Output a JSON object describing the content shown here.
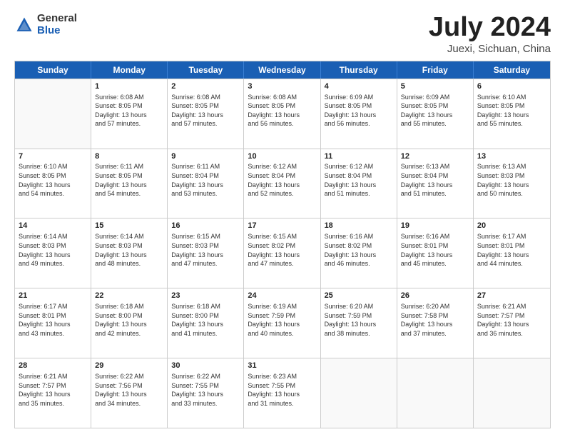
{
  "logo": {
    "general": "General",
    "blue": "Blue"
  },
  "title": "July 2024",
  "subtitle": "Juexi, Sichuan, China",
  "header_days": [
    "Sunday",
    "Monday",
    "Tuesday",
    "Wednesday",
    "Thursday",
    "Friday",
    "Saturday"
  ],
  "weeks": [
    [
      {
        "day": "",
        "info": ""
      },
      {
        "day": "1",
        "info": "Sunrise: 6:08 AM\nSunset: 8:05 PM\nDaylight: 13 hours\nand 57 minutes."
      },
      {
        "day": "2",
        "info": "Sunrise: 6:08 AM\nSunset: 8:05 PM\nDaylight: 13 hours\nand 57 minutes."
      },
      {
        "day": "3",
        "info": "Sunrise: 6:08 AM\nSunset: 8:05 PM\nDaylight: 13 hours\nand 56 minutes."
      },
      {
        "day": "4",
        "info": "Sunrise: 6:09 AM\nSunset: 8:05 PM\nDaylight: 13 hours\nand 56 minutes."
      },
      {
        "day": "5",
        "info": "Sunrise: 6:09 AM\nSunset: 8:05 PM\nDaylight: 13 hours\nand 55 minutes."
      },
      {
        "day": "6",
        "info": "Sunrise: 6:10 AM\nSunset: 8:05 PM\nDaylight: 13 hours\nand 55 minutes."
      }
    ],
    [
      {
        "day": "7",
        "info": "Sunrise: 6:10 AM\nSunset: 8:05 PM\nDaylight: 13 hours\nand 54 minutes."
      },
      {
        "day": "8",
        "info": "Sunrise: 6:11 AM\nSunset: 8:05 PM\nDaylight: 13 hours\nand 54 minutes."
      },
      {
        "day": "9",
        "info": "Sunrise: 6:11 AM\nSunset: 8:04 PM\nDaylight: 13 hours\nand 53 minutes."
      },
      {
        "day": "10",
        "info": "Sunrise: 6:12 AM\nSunset: 8:04 PM\nDaylight: 13 hours\nand 52 minutes."
      },
      {
        "day": "11",
        "info": "Sunrise: 6:12 AM\nSunset: 8:04 PM\nDaylight: 13 hours\nand 51 minutes."
      },
      {
        "day": "12",
        "info": "Sunrise: 6:13 AM\nSunset: 8:04 PM\nDaylight: 13 hours\nand 51 minutes."
      },
      {
        "day": "13",
        "info": "Sunrise: 6:13 AM\nSunset: 8:03 PM\nDaylight: 13 hours\nand 50 minutes."
      }
    ],
    [
      {
        "day": "14",
        "info": "Sunrise: 6:14 AM\nSunset: 8:03 PM\nDaylight: 13 hours\nand 49 minutes."
      },
      {
        "day": "15",
        "info": "Sunrise: 6:14 AM\nSunset: 8:03 PM\nDaylight: 13 hours\nand 48 minutes."
      },
      {
        "day": "16",
        "info": "Sunrise: 6:15 AM\nSunset: 8:03 PM\nDaylight: 13 hours\nand 47 minutes."
      },
      {
        "day": "17",
        "info": "Sunrise: 6:15 AM\nSunset: 8:02 PM\nDaylight: 13 hours\nand 47 minutes."
      },
      {
        "day": "18",
        "info": "Sunrise: 6:16 AM\nSunset: 8:02 PM\nDaylight: 13 hours\nand 46 minutes."
      },
      {
        "day": "19",
        "info": "Sunrise: 6:16 AM\nSunset: 8:01 PM\nDaylight: 13 hours\nand 45 minutes."
      },
      {
        "day": "20",
        "info": "Sunrise: 6:17 AM\nSunset: 8:01 PM\nDaylight: 13 hours\nand 44 minutes."
      }
    ],
    [
      {
        "day": "21",
        "info": "Sunrise: 6:17 AM\nSunset: 8:01 PM\nDaylight: 13 hours\nand 43 minutes."
      },
      {
        "day": "22",
        "info": "Sunrise: 6:18 AM\nSunset: 8:00 PM\nDaylight: 13 hours\nand 42 minutes."
      },
      {
        "day": "23",
        "info": "Sunrise: 6:18 AM\nSunset: 8:00 PM\nDaylight: 13 hours\nand 41 minutes."
      },
      {
        "day": "24",
        "info": "Sunrise: 6:19 AM\nSunset: 7:59 PM\nDaylight: 13 hours\nand 40 minutes."
      },
      {
        "day": "25",
        "info": "Sunrise: 6:20 AM\nSunset: 7:59 PM\nDaylight: 13 hours\nand 38 minutes."
      },
      {
        "day": "26",
        "info": "Sunrise: 6:20 AM\nSunset: 7:58 PM\nDaylight: 13 hours\nand 37 minutes."
      },
      {
        "day": "27",
        "info": "Sunrise: 6:21 AM\nSunset: 7:57 PM\nDaylight: 13 hours\nand 36 minutes."
      }
    ],
    [
      {
        "day": "28",
        "info": "Sunrise: 6:21 AM\nSunset: 7:57 PM\nDaylight: 13 hours\nand 35 minutes."
      },
      {
        "day": "29",
        "info": "Sunrise: 6:22 AM\nSunset: 7:56 PM\nDaylight: 13 hours\nand 34 minutes."
      },
      {
        "day": "30",
        "info": "Sunrise: 6:22 AM\nSunset: 7:55 PM\nDaylight: 13 hours\nand 33 minutes."
      },
      {
        "day": "31",
        "info": "Sunrise: 6:23 AM\nSunset: 7:55 PM\nDaylight: 13 hours\nand 31 minutes."
      },
      {
        "day": "",
        "info": ""
      },
      {
        "day": "",
        "info": ""
      },
      {
        "day": "",
        "info": ""
      }
    ]
  ]
}
